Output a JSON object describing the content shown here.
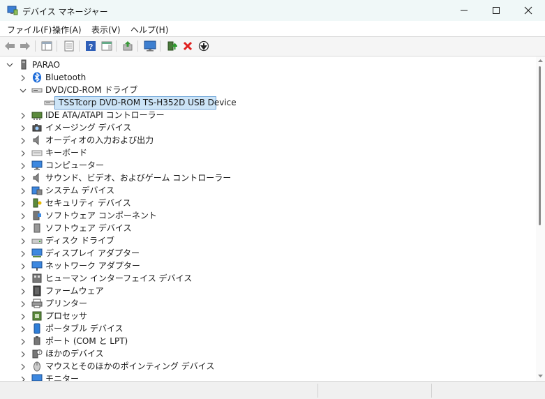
{
  "window": {
    "title": "デバイス マネージャー"
  },
  "menu": [
    {
      "label": "ファイル(F)"
    },
    {
      "label": "操作(A)"
    },
    {
      "label": "表示(V)"
    },
    {
      "label": "ヘルプ(H)"
    }
  ],
  "tree": {
    "root": "PARAO",
    "expanded": {
      "label": "DVD/CD-ROM ドライブ",
      "child": "TSSTcorp DVD-ROM TS-H352D USB Device"
    },
    "items": [
      "Bluetooth",
      "DVD/CD-ROM ドライブ",
      "TSSTcorp DVD-ROM TS-H352D USB Device",
      "IDE ATA/ATAPI コントローラー",
      "イメージング デバイス",
      "オーディオの入力および出力",
      "キーボード",
      "コンピューター",
      "サウンド、ビデオ、およびゲーム コントローラー",
      "システム デバイス",
      "セキュリティ デバイス",
      "ソフトウェア コンポーネント",
      "ソフトウェア デバイス",
      "ディスク ドライブ",
      "ディスプレイ アダプター",
      "ネットワーク アダプター",
      "ヒューマン インターフェイス デバイス",
      "ファームウェア",
      "プリンター",
      "プロセッサ",
      "ポータブル デバイス",
      "ポート (COM と LPT)",
      "ほかのデバイス",
      "マウスとそのほかのポインティング デバイス",
      "モニター"
    ]
  },
  "colors": {
    "accent": "#0067c0",
    "selection": "#cce4f7",
    "selection_border": "#6aa2d6"
  }
}
